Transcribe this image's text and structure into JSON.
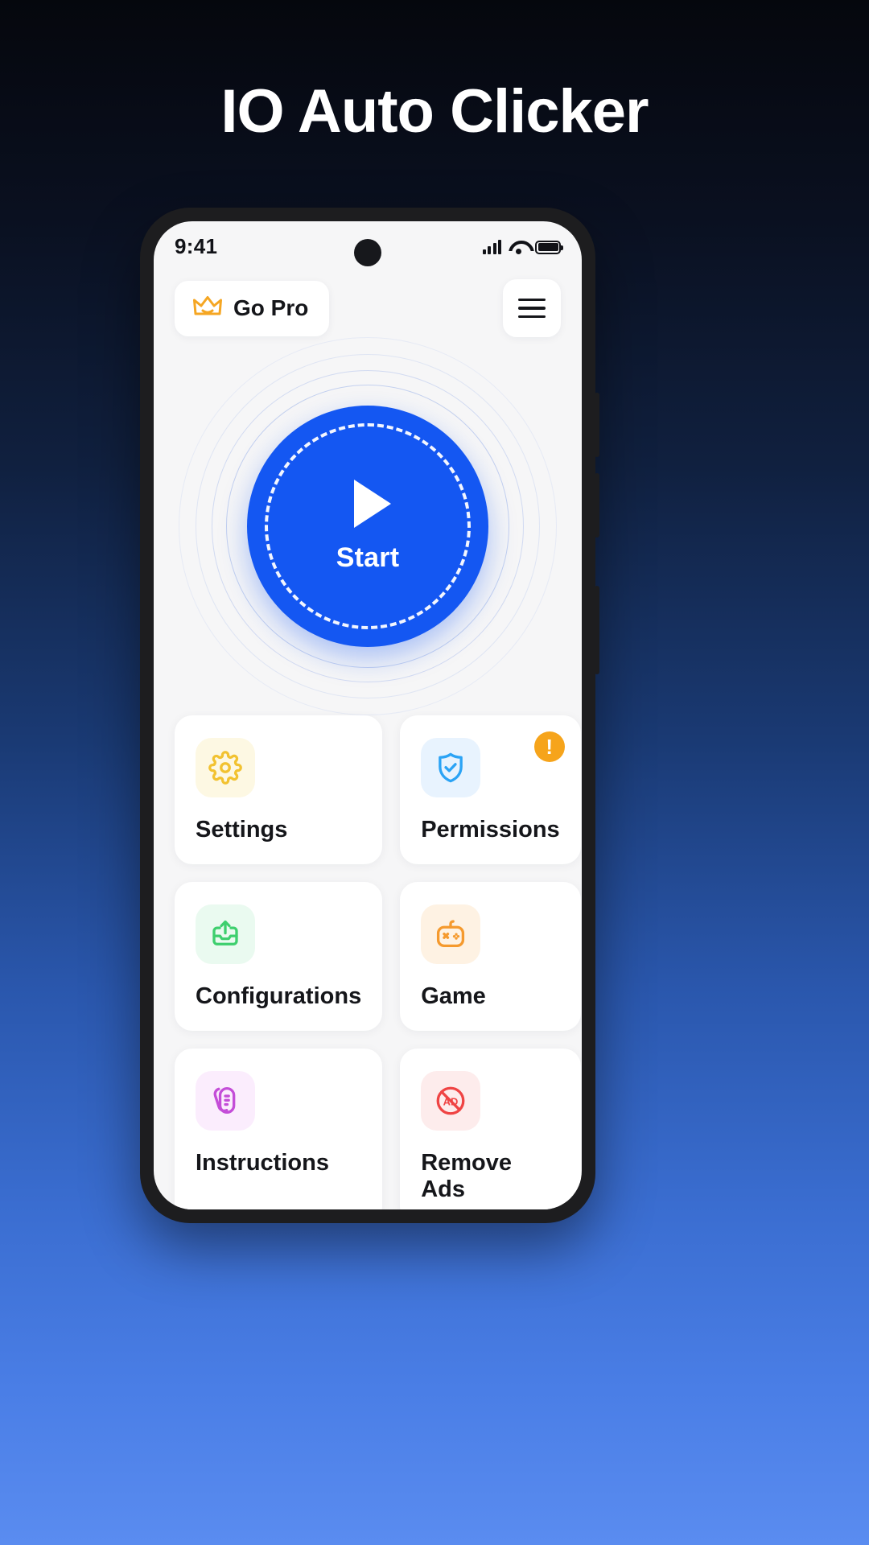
{
  "page": {
    "title": "IO Auto Clicker"
  },
  "phone": {
    "statusbar": {
      "time": "9:41",
      "signal_icon": "signal-bars-icon",
      "wifi_icon": "wifi-icon",
      "battery_icon": "battery-full-icon",
      "camera_icon": "front-camera-punch-hole"
    },
    "topbar": {
      "go_pro_label": "Go Pro",
      "crown_icon": "crown-icon",
      "menu_icon": "hamburger-menu-icon"
    },
    "start": {
      "label": "Start",
      "play_icon": "play-triangle-icon",
      "color": "#1457F2"
    },
    "grid": [
      {
        "label": "Settings",
        "icon": "gear-icon",
        "icon_color": "#F2C230",
        "icon_bg": "#FDF8E3",
        "badge": null
      },
      {
        "label": "Permissions",
        "icon": "shield-check-icon",
        "icon_color": "#2BA3F5",
        "icon_bg": "#E8F3FE",
        "badge": "!"
      },
      {
        "label": "Configurations",
        "icon": "upload-tray-icon",
        "icon_color": "#3ECF6E",
        "icon_bg": "#EAFAF0",
        "badge": null
      },
      {
        "label": "Game",
        "icon": "gamepad-icon",
        "icon_color": "#F59A2E",
        "icon_bg": "#FEF2E3",
        "badge": null
      },
      {
        "label": "Instructions",
        "icon": "instructions-book-icon",
        "icon_color": "#C44DD8",
        "icon_bg": "#FBEDFD",
        "badge": null
      },
      {
        "label": "Remove Ads",
        "icon": "no-ads-icon",
        "icon_color": "#EF4444",
        "icon_bg": "#FDECEC",
        "badge": null
      }
    ]
  }
}
